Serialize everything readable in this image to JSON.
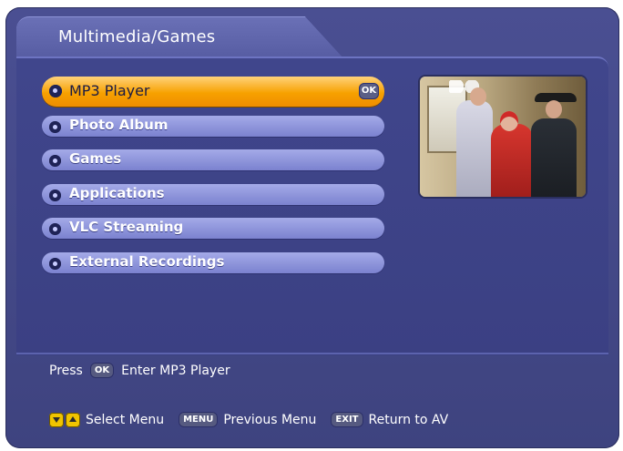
{
  "header": {
    "title": "Multimedia/Games"
  },
  "menu": {
    "items": [
      {
        "label": "MP3 Player",
        "selected": true,
        "ok_label": "OK"
      },
      {
        "label": "Photo Album",
        "selected": false
      },
      {
        "label": "Games",
        "selected": false
      },
      {
        "label": "Applications",
        "selected": false
      },
      {
        "label": "VLC Streaming",
        "selected": false
      },
      {
        "label": "External Recordings",
        "selected": false
      }
    ]
  },
  "preview": {
    "kind": "video-thumbnail"
  },
  "hint": {
    "press_label": "Press",
    "key_label": "OK",
    "action_label": "Enter MP3 Player"
  },
  "legend": {
    "select_label": "Select Menu",
    "menu_key": "MENU",
    "previous_label": "Previous Menu",
    "exit_key": "EXIT",
    "return_label": "Return to AV"
  },
  "colors": {
    "panel": "#40468c",
    "selected_bar": "#f7a100",
    "item_bar": "#8f96dc",
    "legend_arrow": "#f0c400"
  },
  "icons": {
    "bullet": "menu-bullet-icon",
    "ok": "ok-button-icon",
    "up": "arrow-up-icon",
    "down": "arrow-down-icon"
  }
}
